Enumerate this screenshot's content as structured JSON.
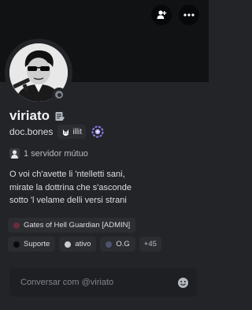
{
  "profile": {
    "display_name": "viriato",
    "username": "doc.bones",
    "guild_tag": "illit",
    "status": "offline",
    "status_color": "#80848e",
    "banner_color": "#111214"
  },
  "mutual": {
    "label": "1 servidor mútuo"
  },
  "bio": {
    "lines": [
      "O voi ch'avette li 'ntelletti sani,",
      "mirate la dottrina che s'asconde",
      "sotto 'l velame delli versi strani"
    ]
  },
  "roles": [
    {
      "label": "Gates of Hell Guardian [ADMIN]",
      "color": "#6b2b3a"
    },
    {
      "label": "Suporte",
      "color": "#0b0b0d"
    },
    {
      "label": "ativo",
      "color": "#c9ccd1"
    },
    {
      "label": "O.G",
      "color": "#4b5470"
    }
  ],
  "more_roles": "+45",
  "message": {
    "placeholder": "Conversar com @viriato"
  },
  "icons": {
    "add_friend": "add-friend-icon",
    "more": "more-icon",
    "note": "note-icon",
    "nitro_badge": "boost-badge-icon",
    "emoji": "emoji-icon"
  }
}
